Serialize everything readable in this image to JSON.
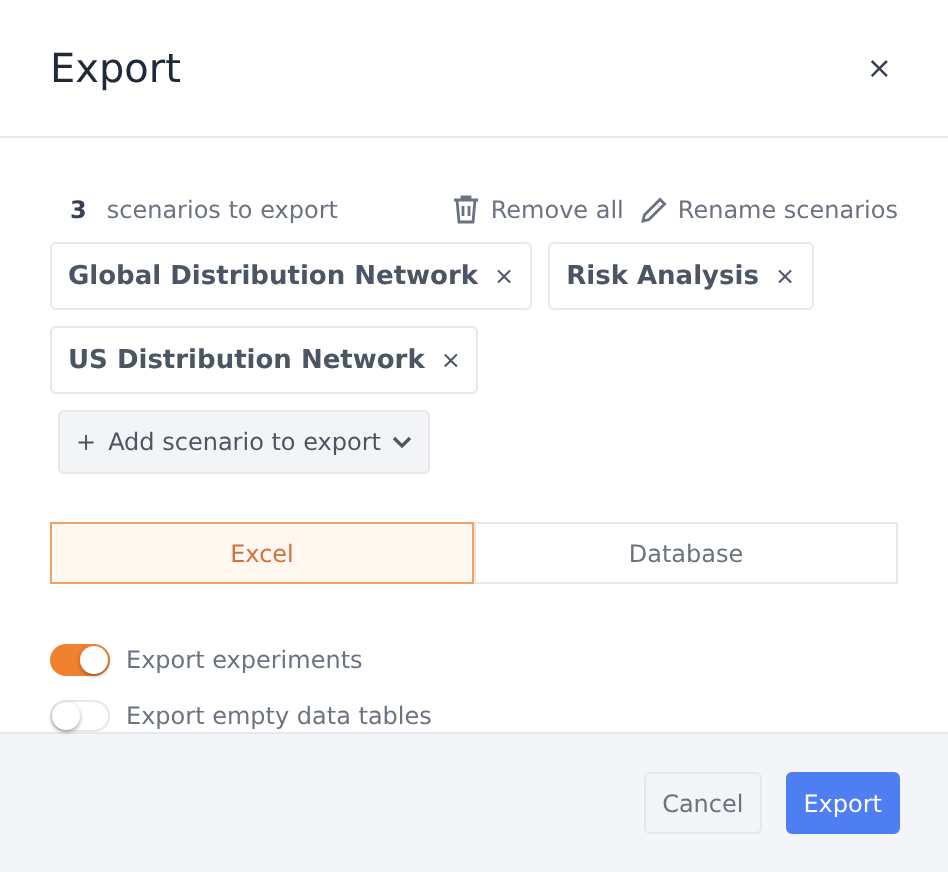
{
  "dialog": {
    "title": "Export",
    "close": "×"
  },
  "count": {
    "number": "3",
    "label": "scenarios to export"
  },
  "actions": [
    {
      "kind": "trash",
      "label": "Remove all"
    },
    {
      "kind": "pencil",
      "label": "Rename scenarios"
    }
  ],
  "scenarios": [
    {
      "name": "Global Distribution Network",
      "remove": "×"
    },
    {
      "name": "Risk Analysis",
      "remove": "×"
    },
    {
      "name": "US Distribution Network",
      "remove": "×"
    }
  ],
  "add_button": {
    "plus": "+",
    "label": "Add scenario to export"
  },
  "tabs": [
    {
      "label": "Excel",
      "selected": true
    },
    {
      "label": "Database",
      "selected": false
    }
  ],
  "toggles": [
    {
      "label": "Export experiments",
      "on": true
    },
    {
      "label": "Export empty data tables",
      "on": false
    }
  ],
  "buttons": [
    {
      "kind": "secondary",
      "label": "Cancel"
    },
    {
      "kind": "primary",
      "label": "Export"
    }
  ]
}
